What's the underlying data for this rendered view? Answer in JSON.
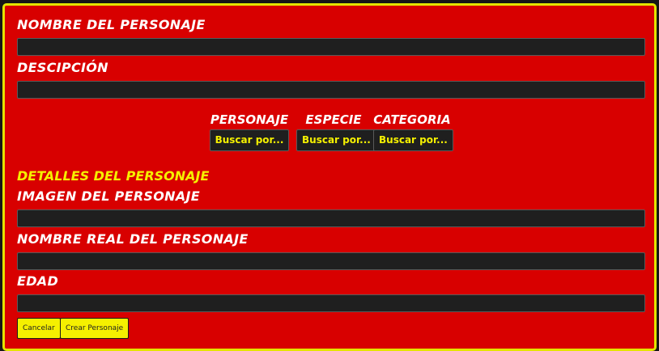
{
  "form": {
    "name_label": "NOMBRE DEL PERSONAJE",
    "name_value": "",
    "description_label": "DESCIPCIÓN",
    "description_value": ""
  },
  "filters": [
    {
      "label": "PERSONAJE",
      "select_text": "Buscar por..."
    },
    {
      "label": "ESPECIE",
      "select_text": "Buscar por..."
    },
    {
      "label": "CATEGORIA",
      "select_text": "Buscar por..."
    }
  ],
  "details": {
    "title": "DETALLES DEL PERSONAJE",
    "image_label": "IMAGEN DEL PERSONAJE",
    "image_value": "",
    "real_name_label": "NOMBRE REAL DEL PERSONAJE",
    "real_name_value": "",
    "age_label": "EDAD",
    "age_value": ""
  },
  "actions": {
    "cancel_label": "Cancelar",
    "create_label": "Crear Personaje"
  },
  "colors": {
    "panel_background": "#d80000",
    "panel_border": "#e4e400",
    "field_background": "#1f1f1f",
    "button_background": "#f5f000",
    "section_title": "#f5f000",
    "label_text": "#ffffff"
  }
}
